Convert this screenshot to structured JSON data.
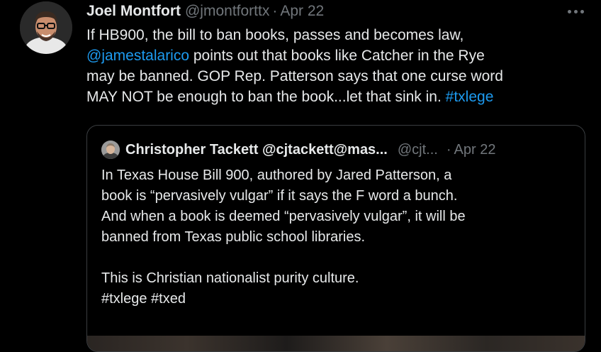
{
  "tweet": {
    "author_name": "Joel Montfort",
    "author_handle": "@jmontforttx",
    "separator": "·",
    "date": "Apr 22",
    "more_icon": "more-horizontal-icon",
    "body_lines": [
      [
        "If HB900, the bill to ban books, passes and becomes law,"
      ],
      [
        "@jamestalarico",
        " points out that books like Catcher in the Rye"
      ],
      [
        "may be banned.  GOP Rep. Patterson says that one curse word"
      ],
      [
        "MAY NOT be enough to ban the book...let that sink in. ",
        "#txlege"
      ]
    ]
  },
  "quote": {
    "author_name": "Christopher Tackett @cjtackett@mas...",
    "author_handle": "@cjt...",
    "separator": "·",
    "date": "Apr 22",
    "paragraph1": [
      "In Texas House Bill 900, authored by Jared Patterson, a",
      "book is “pervasively vulgar” if it says the F word a bunch.",
      "And when a book is deemed “pervasively vulgar”, it will be",
      "banned from Texas public school libraries."
    ],
    "paragraph2": [
      "This is Christian nationalist purity culture.",
      "#txlege #txed"
    ]
  },
  "colors": {
    "background": "#000000",
    "text": "#e7e9ea",
    "secondary": "#71767b",
    "link": "#1d9bf0",
    "border": "#3a3d40"
  }
}
